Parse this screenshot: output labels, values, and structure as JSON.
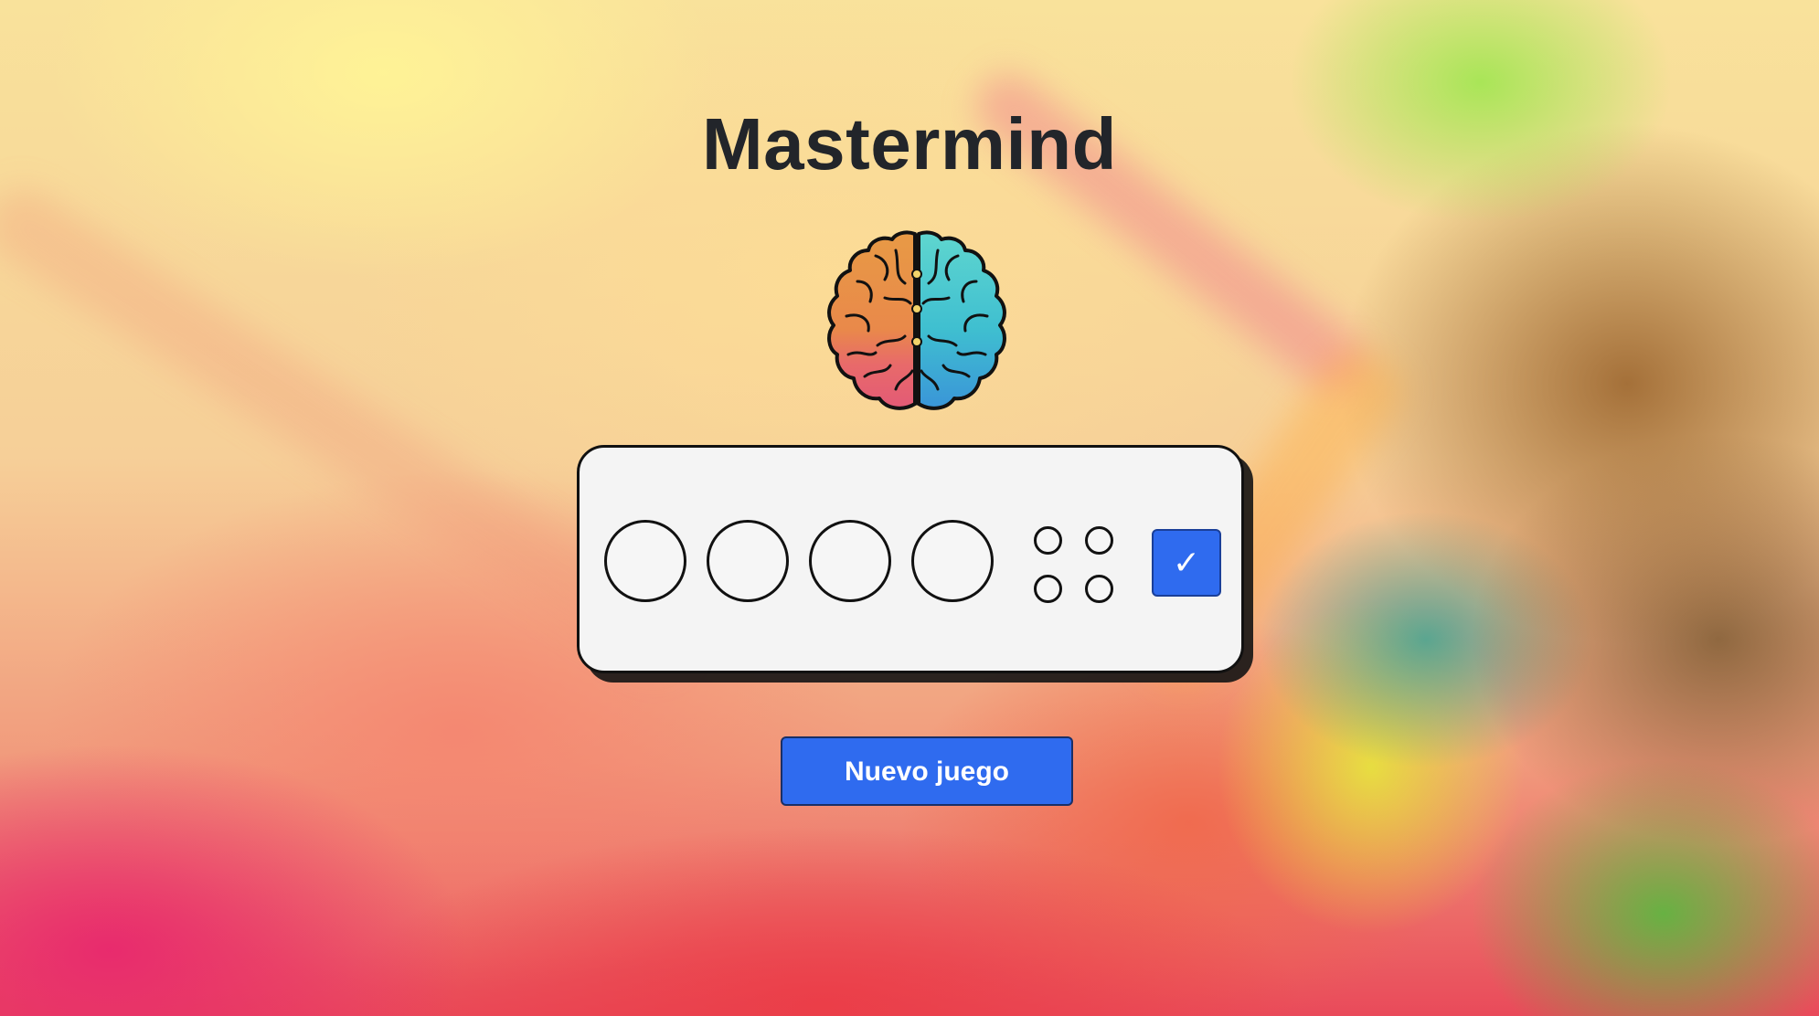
{
  "game": {
    "title": "Mastermind",
    "logo_icon": "brain-icon",
    "guess_slots": [
      "",
      "",
      "",
      ""
    ],
    "feedback_pegs": [
      "",
      "",
      "",
      ""
    ],
    "check_label": "✓",
    "new_game_label": "Nuevo juego"
  },
  "colors": {
    "accent": "#2f6bef",
    "board": "#f4f4f4",
    "text": "#22252a"
  }
}
